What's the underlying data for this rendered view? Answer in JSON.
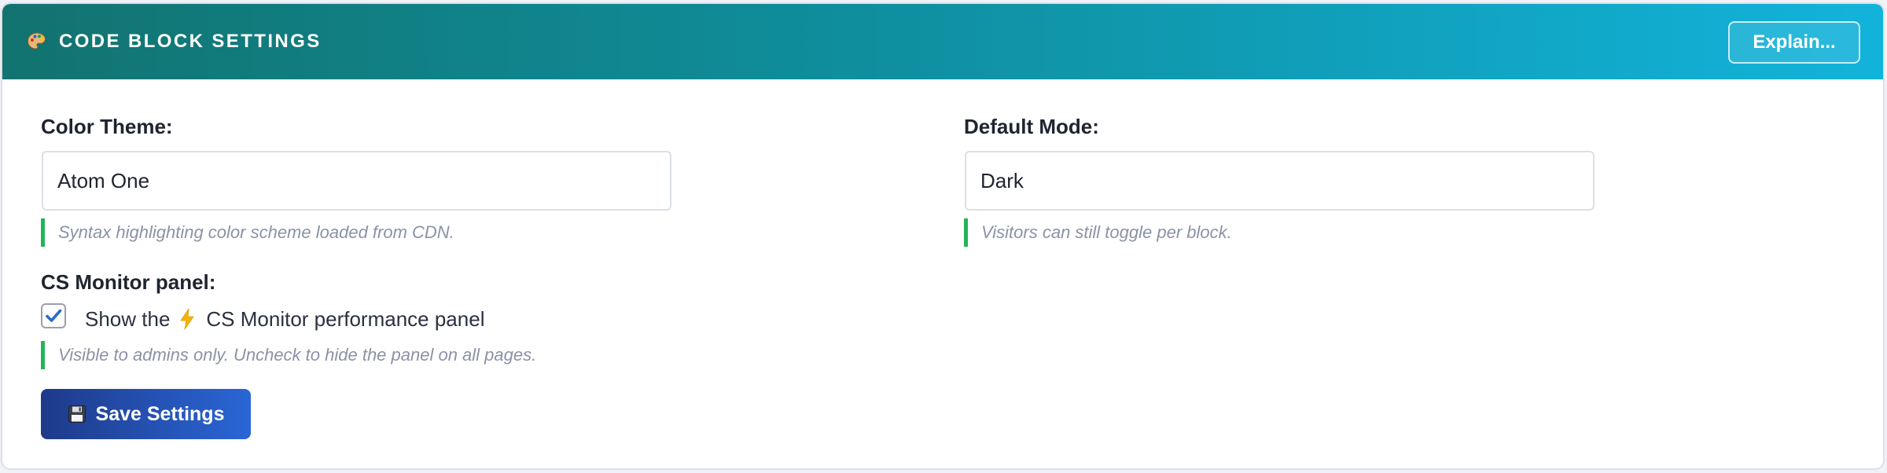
{
  "header": {
    "title": "CODE BLOCK SETTINGS",
    "title_icon": "palette-icon",
    "explain_label": "Explain..."
  },
  "color_theme": {
    "label": "Color Theme:",
    "value": "Atom One",
    "hint": "Syntax highlighting color scheme loaded from CDN."
  },
  "default_mode": {
    "label": "Default Mode:",
    "value": "Dark",
    "hint": "Visitors can still toggle per block."
  },
  "monitor_panel": {
    "label": "CS Monitor panel:",
    "checked": true,
    "checkbox_text_before": "Show the",
    "checkbox_icon": "lightning-bolt-icon",
    "checkbox_text_after": "CS Monitor performance panel",
    "hint": "Visible to admins only. Uncheck to hide the panel on all pages."
  },
  "save_button": {
    "label": "Save Settings",
    "icon": "floppy-disk-icon"
  },
  "colors": {
    "header_gradient_start": "#12736f",
    "header_gradient_end": "#12b3db",
    "hint_accent": "#22b45a",
    "save_gradient_start": "#1e3a8a",
    "save_gradient_end": "#2a66d6",
    "checkbox_check": "#2a6cc4"
  }
}
